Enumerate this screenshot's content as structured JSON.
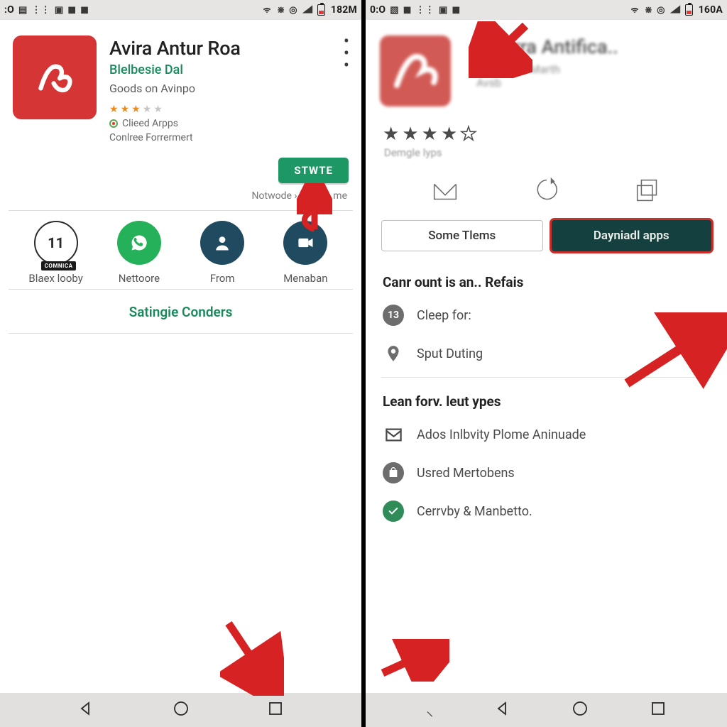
{
  "left": {
    "statusbar": {
      "clock": ":O",
      "tail": "182M"
    },
    "app": {
      "title": "Avira Antur Roa",
      "developer": "Blelbesie Dal",
      "subtitle": "Goods on Avinpo",
      "rated_on": 3,
      "meta1": "Clieed Arpps",
      "meta2": "Conlree Forrermert"
    },
    "cta": "STWTE",
    "sub_right": "Notwode › Stume    me",
    "share": [
      {
        "num": "11",
        "badge": "COMNICA",
        "label": "Blaex looby"
      },
      {
        "label": "Nettoore"
      },
      {
        "label": "From"
      },
      {
        "label": "Menaban"
      }
    ],
    "sectionlink": "Satingie Conders"
  },
  "right": {
    "statusbar": {
      "clock": "0:O",
      "tail": "160A"
    },
    "app": {
      "title": "Kavirra Antifica..",
      "sub1": "Mamasde.Marth",
      "sub2": "Avsb"
    },
    "rated_on": 4,
    "rating_sub": "Demgle lyps",
    "buttons": {
      "outline": "Some Tlems",
      "solid": "Dayniadl apps"
    },
    "section1": "Canr ount is an.. Refais",
    "rows1": [
      {
        "icon_text": "13",
        "label": "Cleep for:"
      },
      {
        "icon": "loc",
        "label": "Sput Duting"
      }
    ],
    "section2": "Lean forv. leut ypes",
    "rows2": [
      {
        "icon": "env",
        "label": "Ados Inlbvity Plome Aninuade"
      },
      {
        "icon": "bag",
        "label": "Usred Mertobens"
      },
      {
        "icon": "chk",
        "label": "Cerrvby & Manbetto."
      }
    ]
  }
}
